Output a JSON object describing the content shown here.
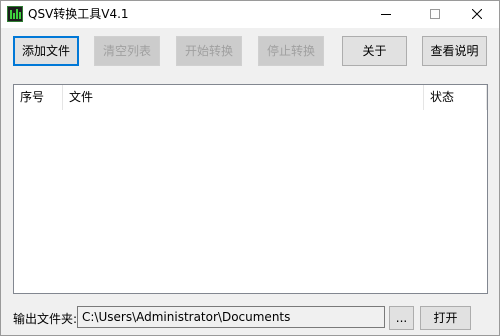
{
  "window": {
    "title": "QSV转换工具V4.1"
  },
  "toolbar": {
    "add_file": "添加文件",
    "clear_list": "清空列表",
    "start_convert": "开始转换",
    "stop_convert": "停止转换",
    "about": "关于",
    "view_help": "查看说明"
  },
  "file_list": {
    "columns": [
      "序号",
      "文件",
      "状态"
    ],
    "rows": []
  },
  "output": {
    "label": "输出文件夹:",
    "path": "C:\\Users\\Administrator\\Documents",
    "browse_label": "...",
    "open_label": "打开"
  },
  "colors": {
    "accent": "#0078d7",
    "window_bg": "#f0f0f0",
    "button_bg": "#e1e1e1",
    "disabled_text": "#a0a0a0"
  },
  "icons": {
    "app": "qsv-app-icon",
    "minimize": "minimize-icon",
    "maximize": "maximize-icon",
    "close": "close-icon"
  }
}
